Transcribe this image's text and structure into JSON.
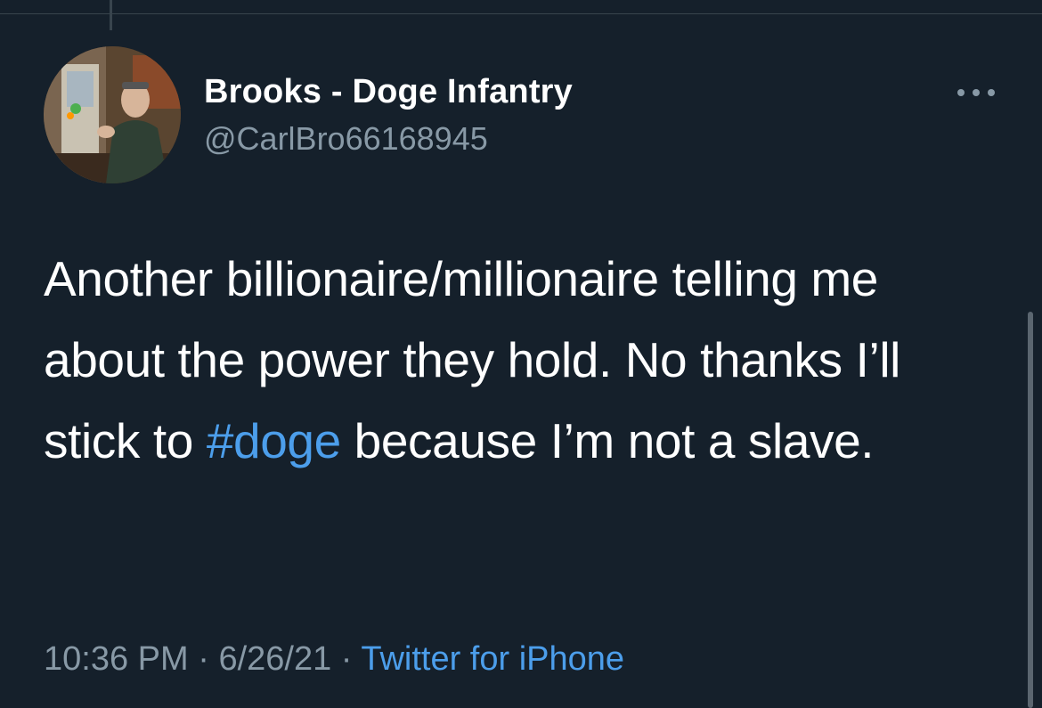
{
  "tweet": {
    "author": {
      "display_name": "Brooks - Doge Infantry",
      "handle": "@CarlBro66168945"
    },
    "text": {
      "part1": "Another billionaire/millionaire telling me about the power they hold. No thanks I’ll stick to ",
      "hashtag": "#doge",
      "part2": " because I’m not a slave."
    },
    "meta": {
      "time": "10:36 PM",
      "separator": "·",
      "date": "6/26/21",
      "source": "Twitter for iPhone"
    }
  },
  "icons": {
    "more": "more-horizontal-icon",
    "avatar": "avatar"
  },
  "colors": {
    "background": "#15202b",
    "text": "#ffffff",
    "secondary": "#8899a6",
    "link": "#4c9eeb",
    "divider": "#38444d"
  }
}
